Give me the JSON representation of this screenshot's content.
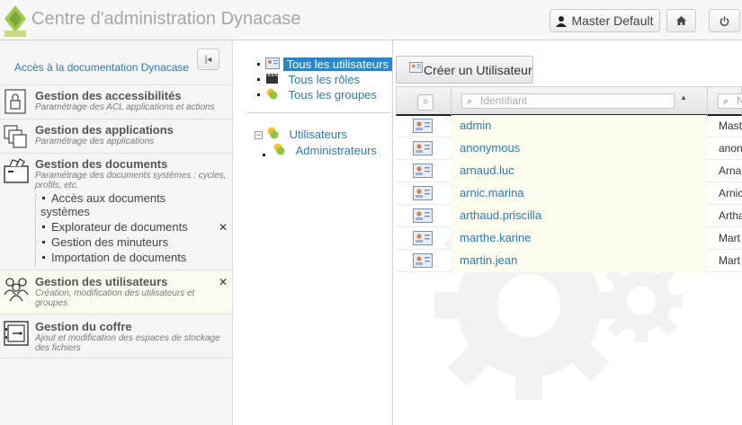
{
  "header": {
    "title": "Centre d'administration Dynacase",
    "user_label": "Master Default"
  },
  "sidebar": {
    "doc_link": "Accès à la documentation Dynacase",
    "items": [
      {
        "title": "Gestion des accessibilités",
        "subtitle": "Paramétrage des ACL applications et actions"
      },
      {
        "title": "Gestion des applications",
        "subtitle": "Paramétrage des applications"
      },
      {
        "title": "Gestion des documents",
        "subtitle": "Paramétrage des documents systèmes : cycles, profils, etc.",
        "children": [
          "Accès aux documents",
          "systèmes",
          "Explorateur de documents",
          "Gestion des minuteurs",
          "Importation de documents"
        ]
      },
      {
        "title": "Gestion des utilisateurs",
        "subtitle": "Création, modification des utilisateurs et groupes"
      },
      {
        "title": "Gestion du coffre",
        "subtitle": "Ajout et modification des espaces de stockage des fichiers"
      }
    ]
  },
  "tree": {
    "top": [
      "Tous les utilisateurs",
      "Tous les rôles",
      "Tous les groupes"
    ],
    "groups_root": "Utilisateurs",
    "groups_child": "Administrateurs"
  },
  "content": {
    "create_button": "Créer un Utilisateur",
    "filter_placeholder": "Identifiant",
    "filter2_placeholder": "N",
    "rows": [
      {
        "id": "admin",
        "name": "Mast"
      },
      {
        "id": "anonymous",
        "name": "anon"
      },
      {
        "id": "arnaud.luc",
        "name": "Arna"
      },
      {
        "id": "arnic.marina",
        "name": "Arnic"
      },
      {
        "id": "arthaud.priscilla",
        "name": "Artha"
      },
      {
        "id": "marthe.karine",
        "name": "Mart"
      },
      {
        "id": "martin.jean",
        "name": "Mart"
      }
    ]
  },
  "colors": {
    "accent": "#2a7cbf",
    "selected": "#2a86c8",
    "active_bg": "#fdfbef"
  }
}
